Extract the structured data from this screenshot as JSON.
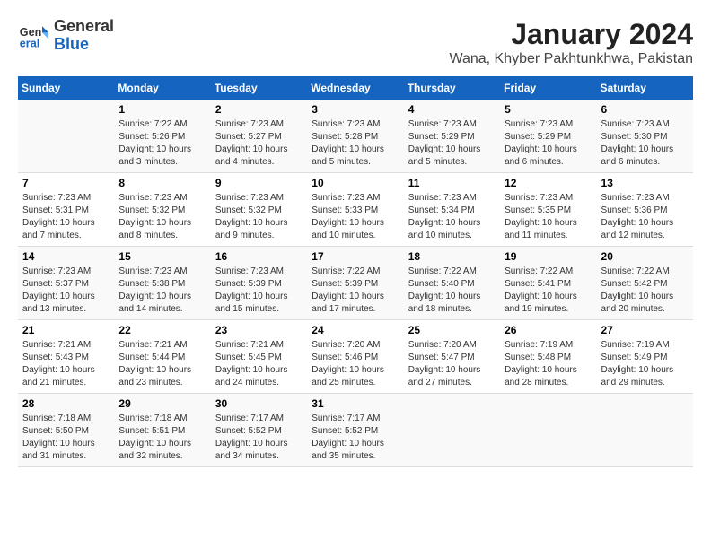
{
  "logo": {
    "general": "General",
    "blue": "Blue"
  },
  "title": "January 2024",
  "subtitle": "Wana, Khyber Pakhtunkhwa, Pakistan",
  "days_of_week": [
    "Sunday",
    "Monday",
    "Tuesday",
    "Wednesday",
    "Thursday",
    "Friday",
    "Saturday"
  ],
  "weeks": [
    [
      {
        "day": "",
        "sunrise": "",
        "sunset": "",
        "daylight": ""
      },
      {
        "day": "1",
        "sunrise": "Sunrise: 7:22 AM",
        "sunset": "Sunset: 5:26 PM",
        "daylight": "Daylight: 10 hours and 3 minutes."
      },
      {
        "day": "2",
        "sunrise": "Sunrise: 7:23 AM",
        "sunset": "Sunset: 5:27 PM",
        "daylight": "Daylight: 10 hours and 4 minutes."
      },
      {
        "day": "3",
        "sunrise": "Sunrise: 7:23 AM",
        "sunset": "Sunset: 5:28 PM",
        "daylight": "Daylight: 10 hours and 5 minutes."
      },
      {
        "day": "4",
        "sunrise": "Sunrise: 7:23 AM",
        "sunset": "Sunset: 5:29 PM",
        "daylight": "Daylight: 10 hours and 5 minutes."
      },
      {
        "day": "5",
        "sunrise": "Sunrise: 7:23 AM",
        "sunset": "Sunset: 5:29 PM",
        "daylight": "Daylight: 10 hours and 6 minutes."
      },
      {
        "day": "6",
        "sunrise": "Sunrise: 7:23 AM",
        "sunset": "Sunset: 5:30 PM",
        "daylight": "Daylight: 10 hours and 6 minutes."
      }
    ],
    [
      {
        "day": "7",
        "sunrise": "Sunrise: 7:23 AM",
        "sunset": "Sunset: 5:31 PM",
        "daylight": "Daylight: 10 hours and 7 minutes."
      },
      {
        "day": "8",
        "sunrise": "Sunrise: 7:23 AM",
        "sunset": "Sunset: 5:32 PM",
        "daylight": "Daylight: 10 hours and 8 minutes."
      },
      {
        "day": "9",
        "sunrise": "Sunrise: 7:23 AM",
        "sunset": "Sunset: 5:32 PM",
        "daylight": "Daylight: 10 hours and 9 minutes."
      },
      {
        "day": "10",
        "sunrise": "Sunrise: 7:23 AM",
        "sunset": "Sunset: 5:33 PM",
        "daylight": "Daylight: 10 hours and 10 minutes."
      },
      {
        "day": "11",
        "sunrise": "Sunrise: 7:23 AM",
        "sunset": "Sunset: 5:34 PM",
        "daylight": "Daylight: 10 hours and 10 minutes."
      },
      {
        "day": "12",
        "sunrise": "Sunrise: 7:23 AM",
        "sunset": "Sunset: 5:35 PM",
        "daylight": "Daylight: 10 hours and 11 minutes."
      },
      {
        "day": "13",
        "sunrise": "Sunrise: 7:23 AM",
        "sunset": "Sunset: 5:36 PM",
        "daylight": "Daylight: 10 hours and 12 minutes."
      }
    ],
    [
      {
        "day": "14",
        "sunrise": "Sunrise: 7:23 AM",
        "sunset": "Sunset: 5:37 PM",
        "daylight": "Daylight: 10 hours and 13 minutes."
      },
      {
        "day": "15",
        "sunrise": "Sunrise: 7:23 AM",
        "sunset": "Sunset: 5:38 PM",
        "daylight": "Daylight: 10 hours and 14 minutes."
      },
      {
        "day": "16",
        "sunrise": "Sunrise: 7:23 AM",
        "sunset": "Sunset: 5:39 PM",
        "daylight": "Daylight: 10 hours and 15 minutes."
      },
      {
        "day": "17",
        "sunrise": "Sunrise: 7:22 AM",
        "sunset": "Sunset: 5:39 PM",
        "daylight": "Daylight: 10 hours and 17 minutes."
      },
      {
        "day": "18",
        "sunrise": "Sunrise: 7:22 AM",
        "sunset": "Sunset: 5:40 PM",
        "daylight": "Daylight: 10 hours and 18 minutes."
      },
      {
        "day": "19",
        "sunrise": "Sunrise: 7:22 AM",
        "sunset": "Sunset: 5:41 PM",
        "daylight": "Daylight: 10 hours and 19 minutes."
      },
      {
        "day": "20",
        "sunrise": "Sunrise: 7:22 AM",
        "sunset": "Sunset: 5:42 PM",
        "daylight": "Daylight: 10 hours and 20 minutes."
      }
    ],
    [
      {
        "day": "21",
        "sunrise": "Sunrise: 7:21 AM",
        "sunset": "Sunset: 5:43 PM",
        "daylight": "Daylight: 10 hours and 21 minutes."
      },
      {
        "day": "22",
        "sunrise": "Sunrise: 7:21 AM",
        "sunset": "Sunset: 5:44 PM",
        "daylight": "Daylight: 10 hours and 23 minutes."
      },
      {
        "day": "23",
        "sunrise": "Sunrise: 7:21 AM",
        "sunset": "Sunset: 5:45 PM",
        "daylight": "Daylight: 10 hours and 24 minutes."
      },
      {
        "day": "24",
        "sunrise": "Sunrise: 7:20 AM",
        "sunset": "Sunset: 5:46 PM",
        "daylight": "Daylight: 10 hours and 25 minutes."
      },
      {
        "day": "25",
        "sunrise": "Sunrise: 7:20 AM",
        "sunset": "Sunset: 5:47 PM",
        "daylight": "Daylight: 10 hours and 27 minutes."
      },
      {
        "day": "26",
        "sunrise": "Sunrise: 7:19 AM",
        "sunset": "Sunset: 5:48 PM",
        "daylight": "Daylight: 10 hours and 28 minutes."
      },
      {
        "day": "27",
        "sunrise": "Sunrise: 7:19 AM",
        "sunset": "Sunset: 5:49 PM",
        "daylight": "Daylight: 10 hours and 29 minutes."
      }
    ],
    [
      {
        "day": "28",
        "sunrise": "Sunrise: 7:18 AM",
        "sunset": "Sunset: 5:50 PM",
        "daylight": "Daylight: 10 hours and 31 minutes."
      },
      {
        "day": "29",
        "sunrise": "Sunrise: 7:18 AM",
        "sunset": "Sunset: 5:51 PM",
        "daylight": "Daylight: 10 hours and 32 minutes."
      },
      {
        "day": "30",
        "sunrise": "Sunrise: 7:17 AM",
        "sunset": "Sunset: 5:52 PM",
        "daylight": "Daylight: 10 hours and 34 minutes."
      },
      {
        "day": "31",
        "sunrise": "Sunrise: 7:17 AM",
        "sunset": "Sunset: 5:52 PM",
        "daylight": "Daylight: 10 hours and 35 minutes."
      },
      {
        "day": "",
        "sunrise": "",
        "sunset": "",
        "daylight": ""
      },
      {
        "day": "",
        "sunrise": "",
        "sunset": "",
        "daylight": ""
      },
      {
        "day": "",
        "sunrise": "",
        "sunset": "",
        "daylight": ""
      }
    ]
  ]
}
